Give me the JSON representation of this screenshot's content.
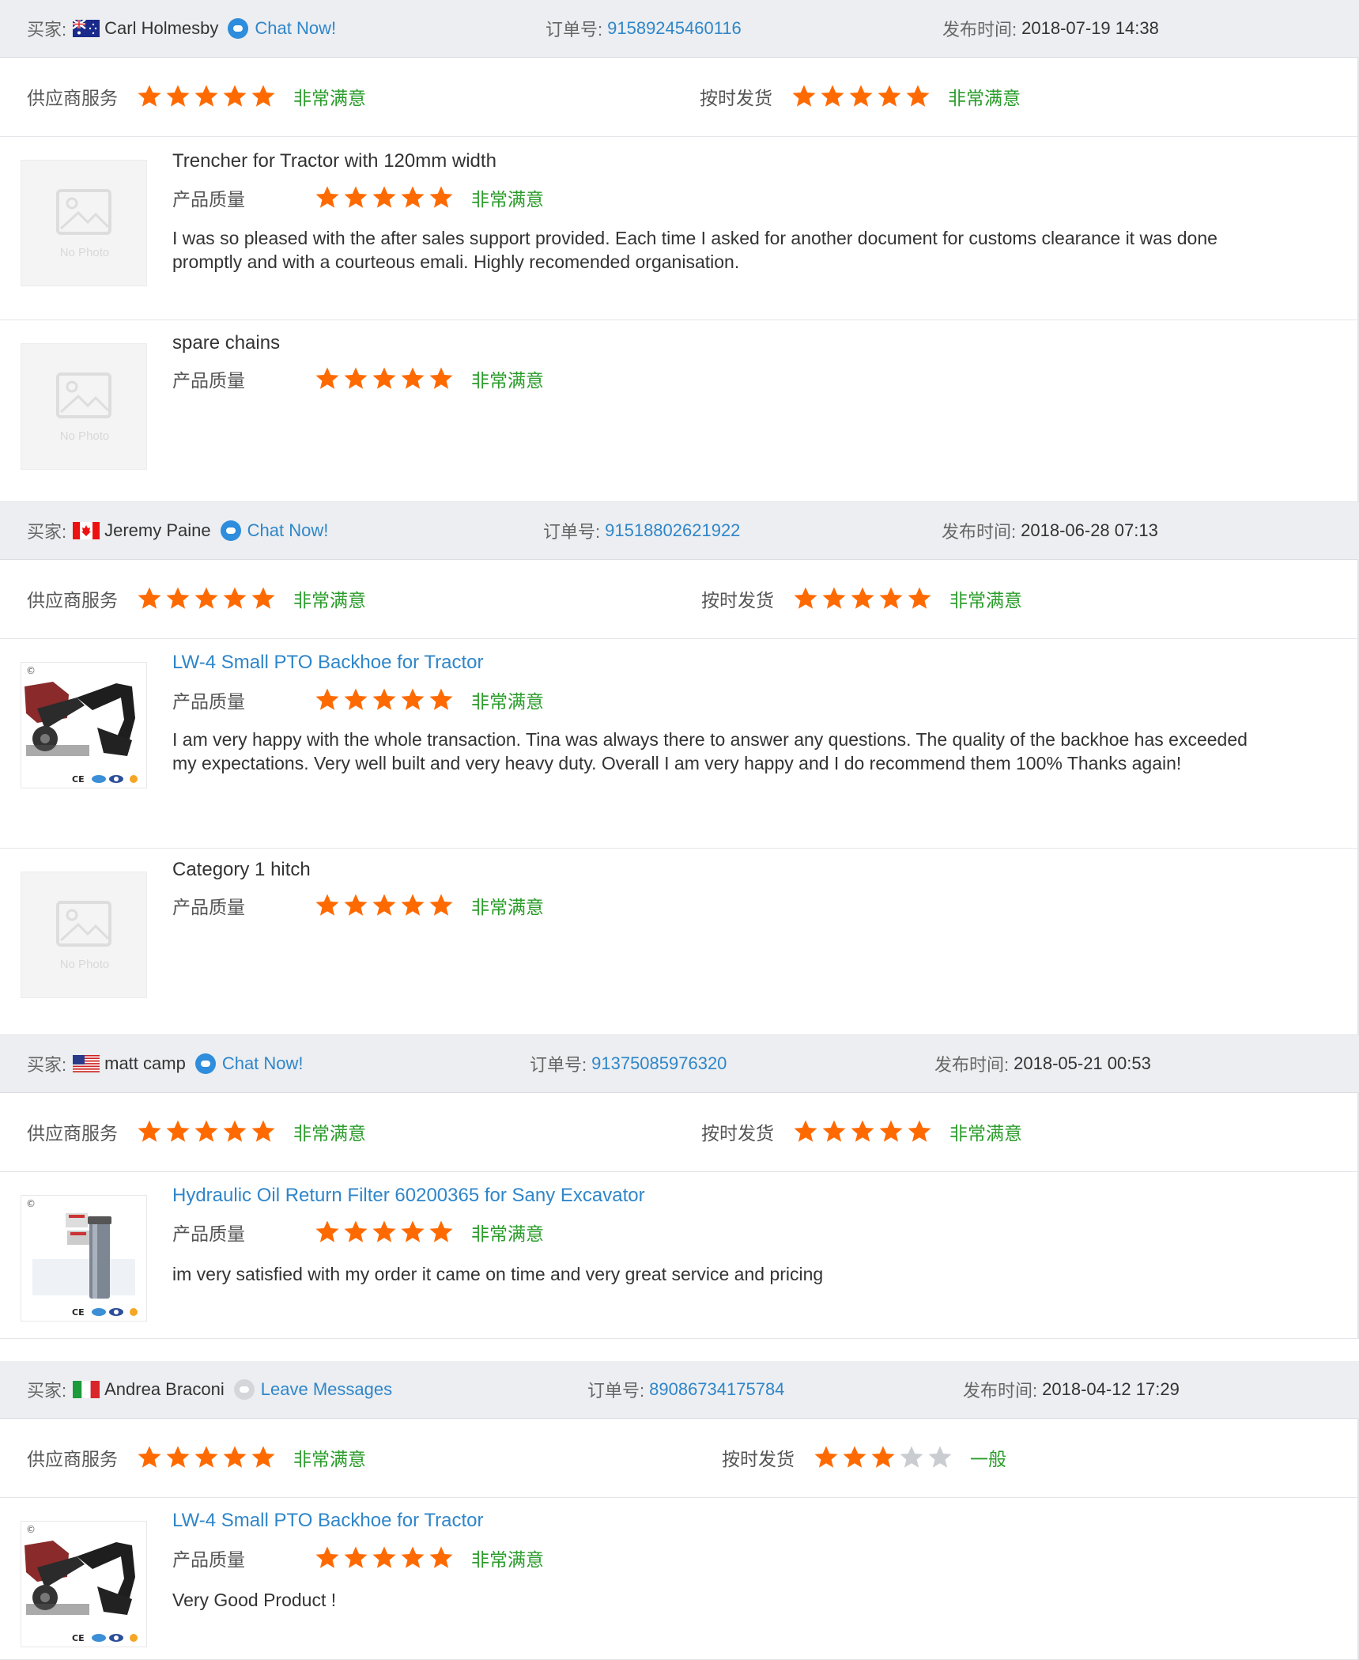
{
  "labels": {
    "buyer": "买家:",
    "order": "订单号:",
    "date": "发布时间:",
    "supplier_service": "供应商服务",
    "on_time": "按时发货",
    "quality": "产品质量",
    "no_photo": "No Photo"
  },
  "colors": {
    "star_on": "#ff6a00",
    "star_off": "#c9ccd1",
    "rating_text": "#2a9c2a",
    "link": "#2f86c9",
    "bar_bg": "#eceef1"
  },
  "reviews": [
    {
      "buyer": {
        "name": "Carl Holmesby",
        "country": "Australia",
        "chat_label": "Chat Now!",
        "chat_active": true
      },
      "order_no": "91589245460116",
      "date": "2018-07-19 14:38",
      "supplier_service": {
        "stars": 5,
        "text": "非常满意"
      },
      "on_time": {
        "stars": 5,
        "text": "非常满意"
      },
      "products": [
        {
          "name": "Trencher for Tractor with 120mm width",
          "is_link": false,
          "photo": false,
          "quality": {
            "stars": 5,
            "text": "非常满意"
          },
          "comment": "I was so pleased with the after sales support provided. Each time I asked for another document for customs clearance it was done promptly and with a courteous emali. Highly recomended organisation."
        },
        {
          "name": "spare chains",
          "is_link": false,
          "photo": false,
          "quality": {
            "stars": 5,
            "text": "非常满意"
          },
          "comment": ""
        }
      ]
    },
    {
      "buyer": {
        "name": "Jeremy Paine",
        "country": "Canada",
        "chat_label": "Chat Now!",
        "chat_active": true
      },
      "order_no": "91518802621922",
      "date": "2018-06-28 07:13",
      "supplier_service": {
        "stars": 5,
        "text": "非常满意"
      },
      "on_time": {
        "stars": 5,
        "text": "非常满意"
      },
      "products": [
        {
          "name": "LW-4 Small PTO Backhoe for Tractor",
          "is_link": true,
          "photo": "backhoe",
          "quality": {
            "stars": 5,
            "text": "非常满意"
          },
          "comment": "I am very happy with the whole transaction. Tina was always there to answer any questions. The quality of the backhoe has exceeded my expectations. Very well built and very heavy duty. Overall I am very happy and I do recommend them 100% Thanks again!"
        },
        {
          "name": "Category 1 hitch",
          "is_link": false,
          "photo": false,
          "quality": {
            "stars": 5,
            "text": "非常满意"
          },
          "comment": ""
        }
      ]
    },
    {
      "buyer": {
        "name": "matt camp",
        "country": "United States",
        "chat_label": "Chat Now!",
        "chat_active": true
      },
      "order_no": "91375085976320",
      "date": "2018-05-21 00:53",
      "supplier_service": {
        "stars": 5,
        "text": "非常满意"
      },
      "on_time": {
        "stars": 5,
        "text": "非常满意"
      },
      "products": [
        {
          "name": "Hydraulic Oil Return Filter 60200365 for Sany Excavator",
          "is_link": true,
          "photo": "filter",
          "quality": {
            "stars": 5,
            "text": "非常满意"
          },
          "comment": "im very satisfied with my order it came on time and very great service and pricing"
        }
      ]
    },
    {
      "buyer": {
        "name": "Andrea Braconi",
        "country": "Italy",
        "chat_label": "Leave Messages",
        "chat_active": false
      },
      "order_no": "89086734175784",
      "date": "2018-04-12 17:29",
      "supplier_service": {
        "stars": 5,
        "text": "非常满意"
      },
      "on_time": {
        "stars": 3,
        "text": "一般"
      },
      "products": [
        {
          "name": "LW-4 Small PTO Backhoe for Tractor",
          "is_link": true,
          "photo": "backhoe",
          "quality": {
            "stars": 5,
            "text": "非常满意"
          },
          "comment": "Very Good Product !"
        }
      ]
    }
  ]
}
